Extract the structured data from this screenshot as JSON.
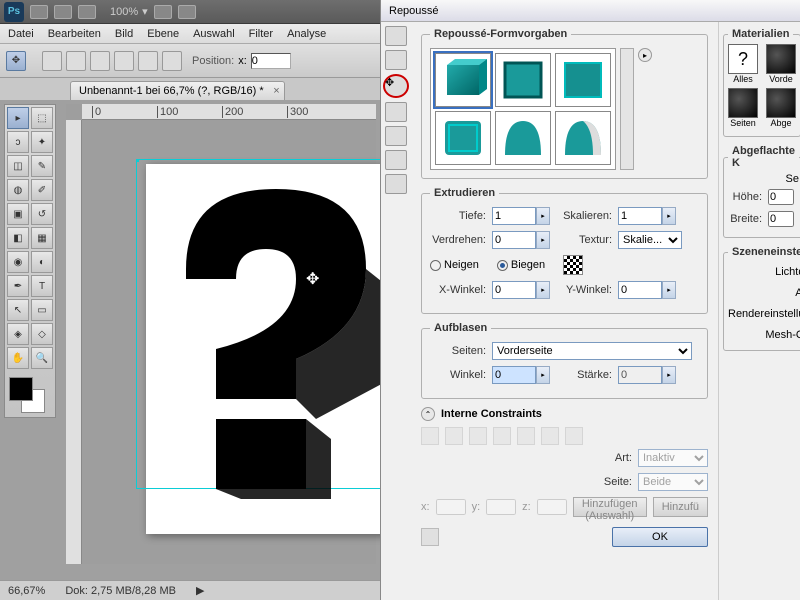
{
  "app": {
    "logo": "Ps",
    "zoom": "100%"
  },
  "menu": [
    "Datei",
    "Bearbeiten",
    "Bild",
    "Ebene",
    "Auswahl",
    "Filter",
    "Analyse"
  ],
  "optionbar": {
    "position": "Position:",
    "x": "x:",
    "xv": "0"
  },
  "doctab": {
    "title": "Unbenannt-1 bei 66,7% (?, RGB/16) *",
    "close": "×"
  },
  "ruler": {
    "marks": [
      "0",
      "100",
      "200",
      "300"
    ]
  },
  "status": {
    "zoom": "66,67%",
    "dok": "Dok: 2,75 MB/8,28 MB"
  },
  "dialog": {
    "title": "Repoussé",
    "presets": {
      "legend": "Repoussé-Formvorgaben"
    },
    "extrude": {
      "legend": "Extrudieren",
      "tiefe": "Tiefe:",
      "tiefe_v": "1",
      "skalieren": "Skalieren:",
      "skalieren_v": "1",
      "verdrehen": "Verdrehen:",
      "verdrehen_v": "0",
      "textur": "Textur:",
      "textur_v": "Skalie...",
      "neigen": "Neigen",
      "biegen": "Biegen",
      "xwinkel": "X-Winkel:",
      "xwinkel_v": "0",
      "ywinkel": "Y-Winkel:",
      "ywinkel_v": "0"
    },
    "aufblasen": {
      "legend": "Aufblasen",
      "seiten": "Seiten:",
      "seiten_v": "Vorderseite",
      "winkel": "Winkel:",
      "winkel_v": "0",
      "staerke": "Stärke:",
      "staerke_v": "0"
    },
    "constraints": {
      "title": "Interne Constraints",
      "art": "Art:",
      "art_v": "Inaktiv",
      "seite": "Seite:",
      "seite_v": "Beide",
      "x": "x:",
      "y": "y:",
      "z": "z:",
      "add": "Hinzufügen (Auswahl)",
      "add2": "Hinzufü"
    },
    "ok": "OK",
    "materials": {
      "legend": "Materialien",
      "alles": "Alles",
      "vorder": "Vorde",
      "seiten": "Seiten",
      "abge": "Abge"
    },
    "flat": {
      "legend": "Abgeflachte K",
      "se": "Se",
      "hoehe": "Höhe:",
      "hoehe_v": "0",
      "breite": "Breite:",
      "breite_v": "0"
    },
    "scene": {
      "legend": "Szeneneinstel",
      "licht": "Lichtque",
      "ansi": "Ansi",
      "render": "Rendereinstellung",
      "mesh": "Mesh-Qua"
    }
  }
}
